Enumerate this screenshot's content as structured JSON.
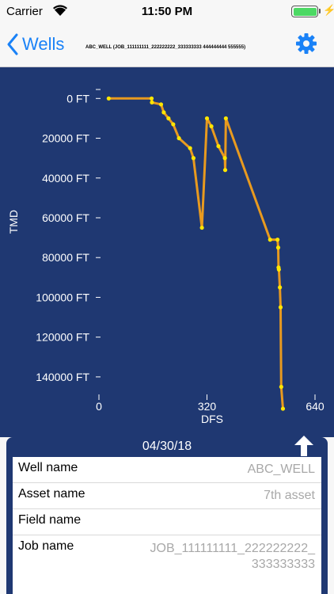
{
  "status_bar": {
    "carrier": "Carrier",
    "time": "11:50 PM"
  },
  "nav": {
    "back_label": "Wells",
    "title": "ABC_WELL (JOB_111111111_222222222_333333333 444444444 555555)"
  },
  "colors": {
    "chart_bg": "#1f3872",
    "line": "#e89a1f",
    "point": "#ffe600",
    "accent": "#1a82f7"
  },
  "chart_data": {
    "type": "line",
    "xlabel": "DFS",
    "ylabel": "TMD",
    "xlim": [
      0,
      640
    ],
    "ylim": [
      150000,
      -4500
    ],
    "x_ticks": [
      "0",
      "320",
      "640"
    ],
    "y_ticks": [
      "0 FT",
      "20000 FT",
      "40000 FT",
      "60000 FT",
      "80000 FT",
      "100000 FT",
      "120000 FT",
      "140000 FT"
    ],
    "grid": false,
    "series": [
      {
        "points": [
          [
            29,
            0
          ],
          [
            156,
            0
          ],
          [
            157,
            2000
          ],
          [
            184,
            3000
          ],
          [
            192,
            7000
          ],
          [
            206,
            10000
          ],
          [
            220,
            13000
          ],
          [
            237,
            20000
          ],
          [
            270,
            25000
          ],
          [
            280,
            30000
          ],
          [
            305,
            65000
          ],
          [
            320,
            10000
          ],
          [
            333,
            14000
          ],
          [
            354,
            24000
          ],
          [
            373,
            30000
          ],
          [
            374,
            36000
          ],
          [
            376,
            10000
          ],
          [
            507,
            71000
          ],
          [
            529,
            71000
          ],
          [
            531,
            75000
          ],
          [
            532,
            85000
          ],
          [
            533,
            86000
          ],
          [
            536,
            95000
          ],
          [
            538,
            105000
          ],
          [
            540,
            145000
          ],
          [
            545,
            156000
          ]
        ]
      }
    ]
  },
  "details": {
    "date": "04/30/18",
    "rows": [
      {
        "label": "Well name",
        "value": "ABC_WELL"
      },
      {
        "label": "Asset name",
        "value": "7th asset"
      },
      {
        "label": "Field name",
        "value": ""
      },
      {
        "label": "Job name",
        "value": "JOB_111111111_222222222_333333333"
      }
    ]
  }
}
